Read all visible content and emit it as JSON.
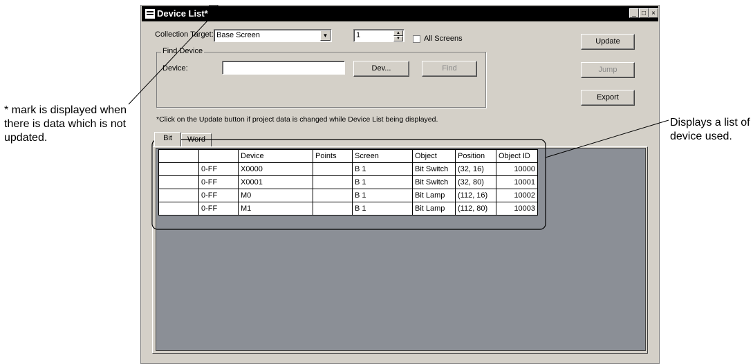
{
  "annotations": {
    "left": "* mark is displayed when there is data which is not updated.",
    "right": "Displays a list of device used."
  },
  "window": {
    "title": "Device List*",
    "controls": {
      "minimize": "_",
      "maximize": "□",
      "close": "×"
    }
  },
  "collection": {
    "label": "Collection Target:",
    "target_value": "Base Screen",
    "screen_number": "1",
    "all_screens_label": "All Screens",
    "all_screens_checked": false
  },
  "find_device": {
    "group_title": "Find Device",
    "device_label": "Device:",
    "device_value": "",
    "dev_button": "Dev...",
    "find_button": "Find"
  },
  "buttons": {
    "update": "Update",
    "jump": "Jump",
    "export": "Export"
  },
  "note": "*Click on the Update button if project data is changed while Device List being displayed.",
  "tabs": [
    "Bit",
    "Word"
  ],
  "table": {
    "columns": [
      "",
      "",
      "Device",
      "Points",
      "Screen",
      "Object",
      "Position",
      "Object ID"
    ],
    "rows": [
      [
        "",
        "0-FF",
        "X0000",
        "",
        "B 1",
        "Bit Switch",
        "(32, 16)",
        "10000"
      ],
      [
        "",
        "0-FF",
        "X0001",
        "",
        "B 1",
        "Bit Switch",
        "(32, 80)",
        "10001"
      ],
      [
        "",
        "0-FF",
        "M0",
        "",
        "B 1",
        "Bit Lamp",
        "(112, 16)",
        "10002"
      ],
      [
        "",
        "0-FF",
        "M1",
        "",
        "B 1",
        "Bit Lamp",
        "(112, 80)",
        "10003"
      ]
    ]
  }
}
